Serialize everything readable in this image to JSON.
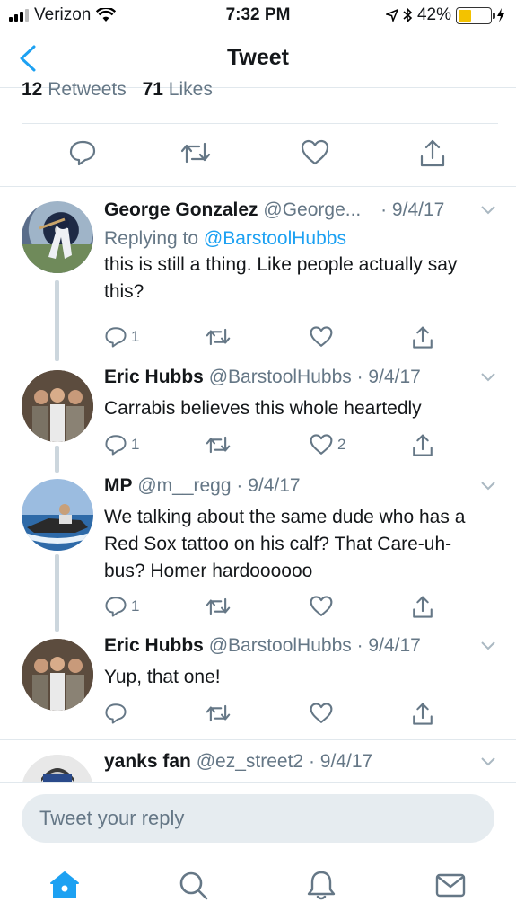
{
  "status_bar": {
    "carrier": "Verizon",
    "time": "7:32 PM",
    "battery": "42%",
    "battery_level": 0.42
  },
  "nav": {
    "title": "Tweet"
  },
  "stats": {
    "retweets_count": "12",
    "retweets_label": "Retweets",
    "likes_count": "71",
    "likes_label": "Likes"
  },
  "replies": [
    {
      "name": "George Gonzalez",
      "handle": "@George...",
      "date": "· 9/4/17",
      "replying_prefix": "Replying to",
      "replying_to": "@BarstoolHubbs",
      "text": "this is still a thing. Like people actually say this?",
      "reply_count": "1",
      "retweet_count": "",
      "like_count": ""
    },
    {
      "name": "Eric Hubbs",
      "handle": "@BarstoolHubbs",
      "date": "· 9/4/17",
      "text": "Carrabis believes this whole heartedly",
      "reply_count": "1",
      "retweet_count": "",
      "like_count": "2"
    },
    {
      "name": "MP",
      "handle": "@m__regg",
      "date": "· 9/4/17",
      "text": "We talking about the same dude who has a Red Sox tattoo on his calf?  That Care-uh-bus?  Homer hardoooooo",
      "reply_count": "1",
      "retweet_count": "",
      "like_count": ""
    },
    {
      "name": "Eric Hubbs",
      "handle": "@BarstoolHubbs",
      "date": "· 9/4/17",
      "text": "Yup, that one!",
      "reply_count": "",
      "retweet_count": "",
      "like_count": ""
    },
    {
      "name": "yanks fan",
      "handle": "@ez_street2",
      "date": "· 9/4/17"
    }
  ],
  "reply_bar": {
    "placeholder": "Tweet your reply"
  },
  "tabs": [
    "home-icon",
    "search-icon",
    "notifications-icon",
    "messages-icon"
  ],
  "colors": {
    "accent": "#1da1f2",
    "secondary": "#657786",
    "battery": "#f3c200"
  }
}
